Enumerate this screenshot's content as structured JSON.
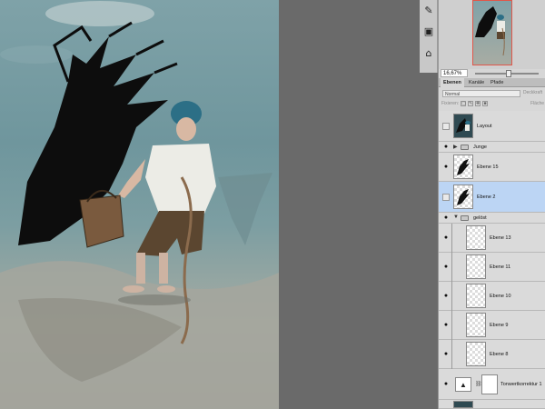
{
  "navigator": {
    "zoom_value": "16,67%"
  },
  "toolstrip": {
    "tools": [
      {
        "icon": "history-brush-icon"
      },
      {
        "icon": "channels-icon"
      },
      {
        "icon": "paths-icon"
      }
    ]
  },
  "layers_panel": {
    "tabs": [
      "Ebenen",
      "Kanäle",
      "Pfade"
    ],
    "active_tab": "Ebenen",
    "blend_mode": "Normal",
    "opacity_label": "Deckkraft",
    "lock_label": "Fixieren:",
    "fill_label": "Fläche",
    "layers": [
      {
        "name": "Layout",
        "visible": false
      },
      {
        "name": "Junge",
        "visible": true,
        "type": "group"
      },
      {
        "name": "Ebene 15",
        "visible": true
      },
      {
        "name": "Ebene 2",
        "visible": false,
        "selected": true
      },
      {
        "name": "gelöst",
        "visible": true,
        "type": "group",
        "expanded": true
      },
      {
        "name": "Ebene 13",
        "visible": true
      },
      {
        "name": "Ebene 11",
        "visible": true
      },
      {
        "name": "Ebene 10",
        "visible": true
      },
      {
        "name": "Ebene 9",
        "visible": true
      },
      {
        "name": "Ebene 8",
        "visible": true
      },
      {
        "name": "Tonwertkorrektur 1",
        "visible": true,
        "type": "adjustment"
      }
    ]
  },
  "colors": {
    "selected_row": "#bcd5f4",
    "panel_bg": "#d7d7d7",
    "workspace_bg": "#6a6a6a",
    "navigator_frame": "#e0574a"
  }
}
